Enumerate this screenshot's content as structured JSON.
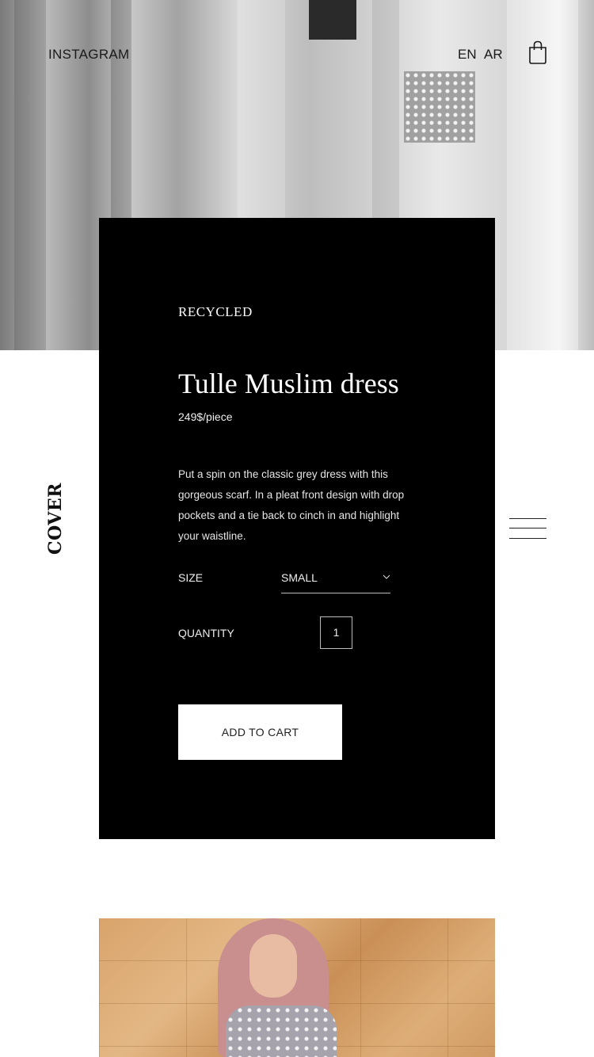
{
  "header": {
    "instagram_label": "INSTAGRAM",
    "languages": [
      "EN",
      "AR"
    ],
    "cart_icon": "shopping-bag-icon"
  },
  "brand": {
    "name": "COVER"
  },
  "menu": {
    "icon": "hamburger-menu-icon"
  },
  "product": {
    "category": "RECYCLED",
    "title": "Tulle Muslim dress",
    "price": "249$/piece",
    "description": "Put a spin on the classic grey dress with this gorgeous scarf. In a pleat front design with drop pockets and a tie back to cinch in and highlight your waistline.",
    "size_label": "SIZE",
    "size_value": "SMALL",
    "quantity_label": "QUANTITY",
    "quantity_value": "1",
    "add_to_cart_label": "ADD TO CART"
  },
  "colors": {
    "card_background": "#000000",
    "page_background": "#ffffff",
    "button_background": "#ffffff"
  }
}
